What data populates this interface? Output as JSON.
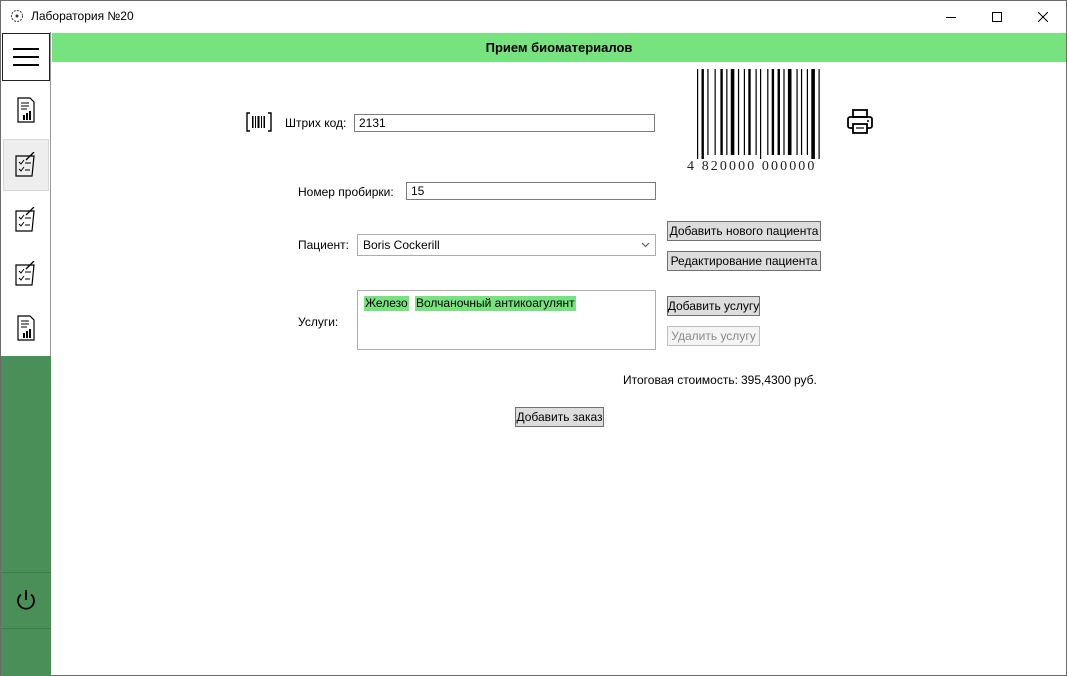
{
  "window": {
    "title": "Лаборатория №20"
  },
  "header": {
    "title": "Прием биоматериалов"
  },
  "form": {
    "barcode_label": "Штрих код:",
    "barcode_value": "2131",
    "tube_label": "Номер пробирки:",
    "tube_value": "15",
    "patient_label": "Пациент:",
    "patient_value": "Boris Cockerill",
    "services_label": "Услуги:",
    "services": [
      "Железо",
      "Волчаночный антикоагулянт"
    ],
    "total_label": "Итоговая стоимость:",
    "total_value": "395,4300",
    "total_currency": "руб."
  },
  "buttons": {
    "add_patient": "Добавить нового пациента",
    "edit_patient": "Редактирование пациента",
    "add_service": "Добавить услугу",
    "remove_service": "Удалить услугу",
    "add_order": "Добавить заказ"
  },
  "barcode_image": {
    "digits": "4 820000 000000"
  },
  "icons": {
    "app": "app-icon",
    "menu": "hamburger-menu-icon",
    "scanner": "barcode-scanner-icon",
    "print": "printer-icon",
    "power": "power-icon"
  },
  "colors": {
    "header_green": "#77e37f",
    "sidebar_green": "#4a8f58",
    "service_highlight": "#77e37f"
  }
}
